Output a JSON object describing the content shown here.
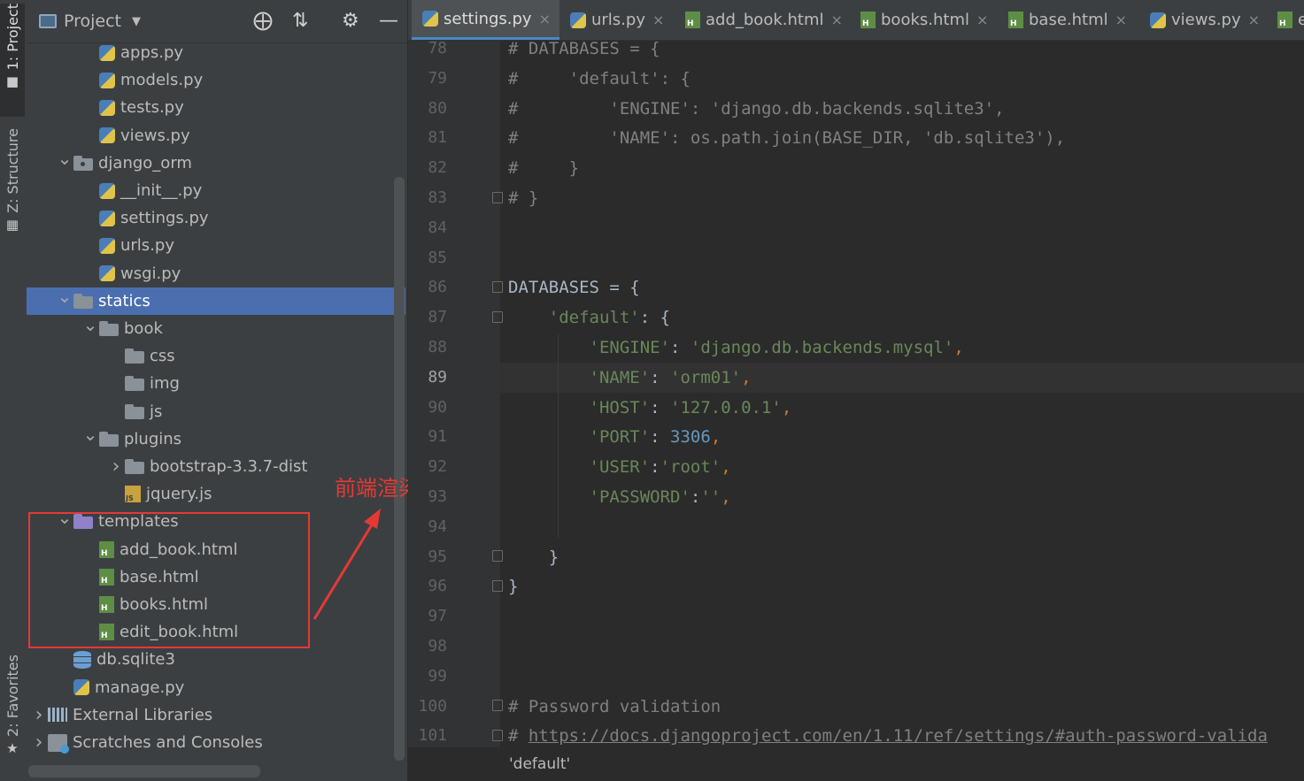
{
  "sidebar_tabs": {
    "project": "1: Project",
    "structure": "Z: Structure",
    "favorites": "2: Favorites"
  },
  "panel": {
    "title": "Project"
  },
  "tree": [
    {
      "label": "apps.py",
      "icon": "python-file-icon",
      "depth": 3,
      "chevron": ""
    },
    {
      "label": "models.py",
      "icon": "python-file-icon",
      "depth": 3,
      "chevron": ""
    },
    {
      "label": "tests.py",
      "icon": "python-file-icon",
      "depth": 3,
      "chevron": ""
    },
    {
      "label": "views.py",
      "icon": "python-file-icon",
      "depth": 3,
      "chevron": ""
    },
    {
      "label": "django_orm",
      "icon": "package-folder-icon",
      "depth": 2,
      "chevron": "expanded"
    },
    {
      "label": "__init__.py",
      "icon": "python-file-icon",
      "depth": 3,
      "chevron": ""
    },
    {
      "label": "settings.py",
      "icon": "python-file-icon",
      "depth": 3,
      "chevron": ""
    },
    {
      "label": "urls.py",
      "icon": "python-file-icon",
      "depth": 3,
      "chevron": ""
    },
    {
      "label": "wsgi.py",
      "icon": "python-file-icon",
      "depth": 3,
      "chevron": ""
    },
    {
      "label": "statics",
      "icon": "folder-icon",
      "depth": 2,
      "chevron": "expanded",
      "selected": true
    },
    {
      "label": "book",
      "icon": "folder-icon",
      "depth": 3,
      "chevron": "expanded"
    },
    {
      "label": "css",
      "icon": "folder-icon",
      "depth": 4,
      "chevron": ""
    },
    {
      "label": "img",
      "icon": "folder-icon",
      "depth": 4,
      "chevron": ""
    },
    {
      "label": "js",
      "icon": "folder-icon",
      "depth": 4,
      "chevron": ""
    },
    {
      "label": "plugins",
      "icon": "folder-icon",
      "depth": 3,
      "chevron": "expanded"
    },
    {
      "label": "bootstrap-3.3.7-dist",
      "icon": "folder-icon",
      "depth": 4,
      "chevron": "collapsed"
    },
    {
      "label": "jquery.js",
      "icon": "javascript-file-icon",
      "depth": 4,
      "chevron": ""
    },
    {
      "label": "templates",
      "icon": "templates-folder-icon",
      "depth": 2,
      "chevron": "expanded"
    },
    {
      "label": "add_book.html",
      "icon": "html-file-icon",
      "depth": 3,
      "chevron": ""
    },
    {
      "label": "base.html",
      "icon": "html-file-icon",
      "depth": 3,
      "chevron": ""
    },
    {
      "label": "books.html",
      "icon": "html-file-icon",
      "depth": 3,
      "chevron": ""
    },
    {
      "label": "edit_book.html",
      "icon": "html-file-icon",
      "depth": 3,
      "chevron": ""
    },
    {
      "label": "db.sqlite3",
      "icon": "database-icon",
      "depth": 2,
      "chevron": ""
    },
    {
      "label": "manage.py",
      "icon": "python-file-icon",
      "depth": 2,
      "chevron": ""
    },
    {
      "label": "External Libraries",
      "icon": "libraries-icon",
      "depth": 1,
      "chevron": "collapsed"
    },
    {
      "label": "Scratches and Consoles",
      "icon": "scratches-icon",
      "depth": 1,
      "chevron": "collapsed"
    }
  ],
  "annotation": {
    "label": "前端渲染文件",
    "color": "#e53935"
  },
  "tabs": [
    {
      "label": "settings.py",
      "icon": "python-file-icon",
      "active": true,
      "close": "×"
    },
    {
      "label": "urls.py",
      "icon": "python-file-icon",
      "close": "×"
    },
    {
      "label": "add_book.html",
      "icon": "html-file-icon",
      "close": "×"
    },
    {
      "label": "books.html",
      "icon": "html-file-icon",
      "close": "×"
    },
    {
      "label": "base.html",
      "icon": "html-file-icon",
      "close": "×"
    },
    {
      "label": "views.py",
      "icon": "python-file-icon",
      "close": "×"
    },
    {
      "label": "e",
      "icon": "html-file-icon",
      "close": ""
    }
  ],
  "editor": {
    "current_line": "89",
    "lines": [
      {
        "n": "78",
        "tokens": [
          {
            "t": "# DATABASES = {",
            "c": "comment"
          }
        ]
      },
      {
        "n": "79",
        "tokens": [
          {
            "t": "#     'default': {",
            "c": "comment"
          }
        ]
      },
      {
        "n": "80",
        "tokens": [
          {
            "t": "#         'ENGINE': 'django.db.backends.sqlite3',",
            "c": "comment"
          }
        ]
      },
      {
        "n": "81",
        "tokens": [
          {
            "t": "#         'NAME': os.path.join(BASE_DIR, 'db.sqlite3'),",
            "c": "comment"
          }
        ]
      },
      {
        "n": "82",
        "tokens": [
          {
            "t": "#     }",
            "c": "comment"
          }
        ]
      },
      {
        "n": "83",
        "tokens": [
          {
            "t": "# }",
            "c": "comment"
          }
        ]
      },
      {
        "n": "84",
        "tokens": []
      },
      {
        "n": "85",
        "tokens": []
      },
      {
        "n": "86",
        "tokens": [
          {
            "t": "DATABASES = {",
            "c": ""
          }
        ]
      },
      {
        "n": "87",
        "tokens": [
          {
            "t": "    ",
            "c": ""
          },
          {
            "t": "'default'",
            "c": "str"
          },
          {
            "t": ": {",
            "c": ""
          }
        ]
      },
      {
        "n": "88",
        "tokens": [
          {
            "t": "        ",
            "c": ""
          },
          {
            "t": "'ENGINE'",
            "c": "str"
          },
          {
            "t": ": ",
            "c": ""
          },
          {
            "t": "'django.db.backends.mysql'",
            "c": "str"
          },
          {
            "t": ",",
            "c": "punc"
          }
        ]
      },
      {
        "n": "89",
        "tokens": [
          {
            "t": "        ",
            "c": ""
          },
          {
            "t": "'NAME'",
            "c": "str"
          },
          {
            "t": ": ",
            "c": ""
          },
          {
            "t": "'orm01'",
            "c": "str"
          },
          {
            "t": ",",
            "c": "punc"
          }
        ]
      },
      {
        "n": "90",
        "tokens": [
          {
            "t": "        ",
            "c": ""
          },
          {
            "t": "'HOST'",
            "c": "str"
          },
          {
            "t": ": ",
            "c": ""
          },
          {
            "t": "'127.0.0.1'",
            "c": "str"
          },
          {
            "t": ",",
            "c": "punc"
          }
        ]
      },
      {
        "n": "91",
        "tokens": [
          {
            "t": "        ",
            "c": ""
          },
          {
            "t": "'PORT'",
            "c": "str"
          },
          {
            "t": ": ",
            "c": ""
          },
          {
            "t": "3306",
            "c": "num"
          },
          {
            "t": ",",
            "c": "punc"
          }
        ]
      },
      {
        "n": "92",
        "tokens": [
          {
            "t": "        ",
            "c": ""
          },
          {
            "t": "'USER'",
            "c": "str"
          },
          {
            "t": ":",
            "c": ""
          },
          {
            "t": "'root'",
            "c": "str"
          },
          {
            "t": ",",
            "c": "punc"
          }
        ]
      },
      {
        "n": "93",
        "tokens": [
          {
            "t": "        ",
            "c": ""
          },
          {
            "t": "'PASSWORD'",
            "c": "str"
          },
          {
            "t": ":",
            "c": ""
          },
          {
            "t": "''",
            "c": "str"
          },
          {
            "t": ",",
            "c": "punc"
          }
        ]
      },
      {
        "n": "94",
        "tokens": []
      },
      {
        "n": "95",
        "tokens": [
          {
            "t": "    }",
            "c": ""
          }
        ]
      },
      {
        "n": "96",
        "tokens": [
          {
            "t": "}",
            "c": ""
          }
        ]
      },
      {
        "n": "97",
        "tokens": []
      },
      {
        "n": "98",
        "tokens": []
      },
      {
        "n": "99",
        "tokens": []
      },
      {
        "n": "100",
        "tokens": [
          {
            "t": "# Password validation",
            "c": "comment"
          }
        ]
      },
      {
        "n": "101",
        "tokens": [
          {
            "t": "# ",
            "c": "comment"
          },
          {
            "t": "https://docs.djangoproject.com/en/1.11/ref/settings/#auth-password-valida",
            "c": "link"
          }
        ]
      }
    ]
  },
  "status": {
    "breadcrumb": "'default'"
  }
}
